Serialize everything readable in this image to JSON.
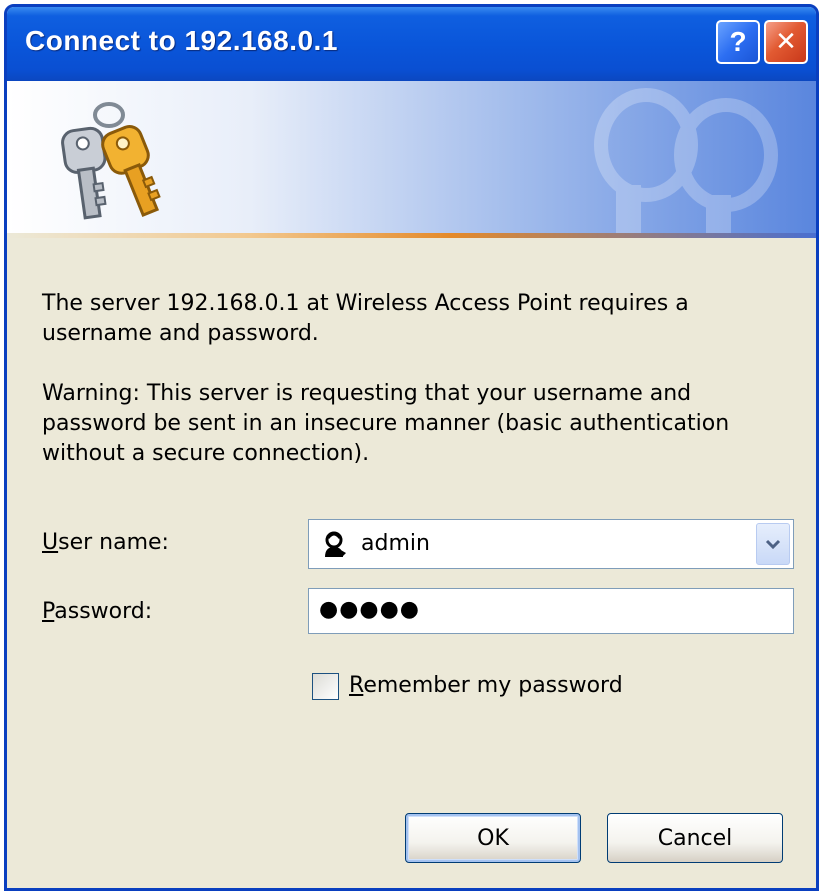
{
  "window": {
    "title": "Connect to 192.168.0.1"
  },
  "titlebar": {
    "help_label": "?",
    "close_label": "✕"
  },
  "message": {
    "line1": "The server 192.168.0.1 at Wireless Access Point requires a username and password.",
    "warning": "Warning: This server is requesting that your username and password be sent in an insecure manner (basic authentication without a secure connection)."
  },
  "form": {
    "username_label_accel": "U",
    "username_label_rest": "ser name:",
    "username_value": "admin",
    "password_label_accel": "P",
    "password_label_rest": "assword:",
    "password_value": "●●●●●",
    "remember_accel": "R",
    "remember_rest": "emember my password",
    "remember_checked": false
  },
  "buttons": {
    "ok_label": "OK",
    "cancel_label": "Cancel"
  },
  "colors": {
    "titlebar": "#0a56da",
    "window_bg": "#ece9d8",
    "close_button": "#e25a32",
    "help_button": "#2c6ef2"
  },
  "icons": {
    "banner": "keys-icon",
    "username": "user-icon",
    "dropdown": "chevron-down-icon"
  }
}
